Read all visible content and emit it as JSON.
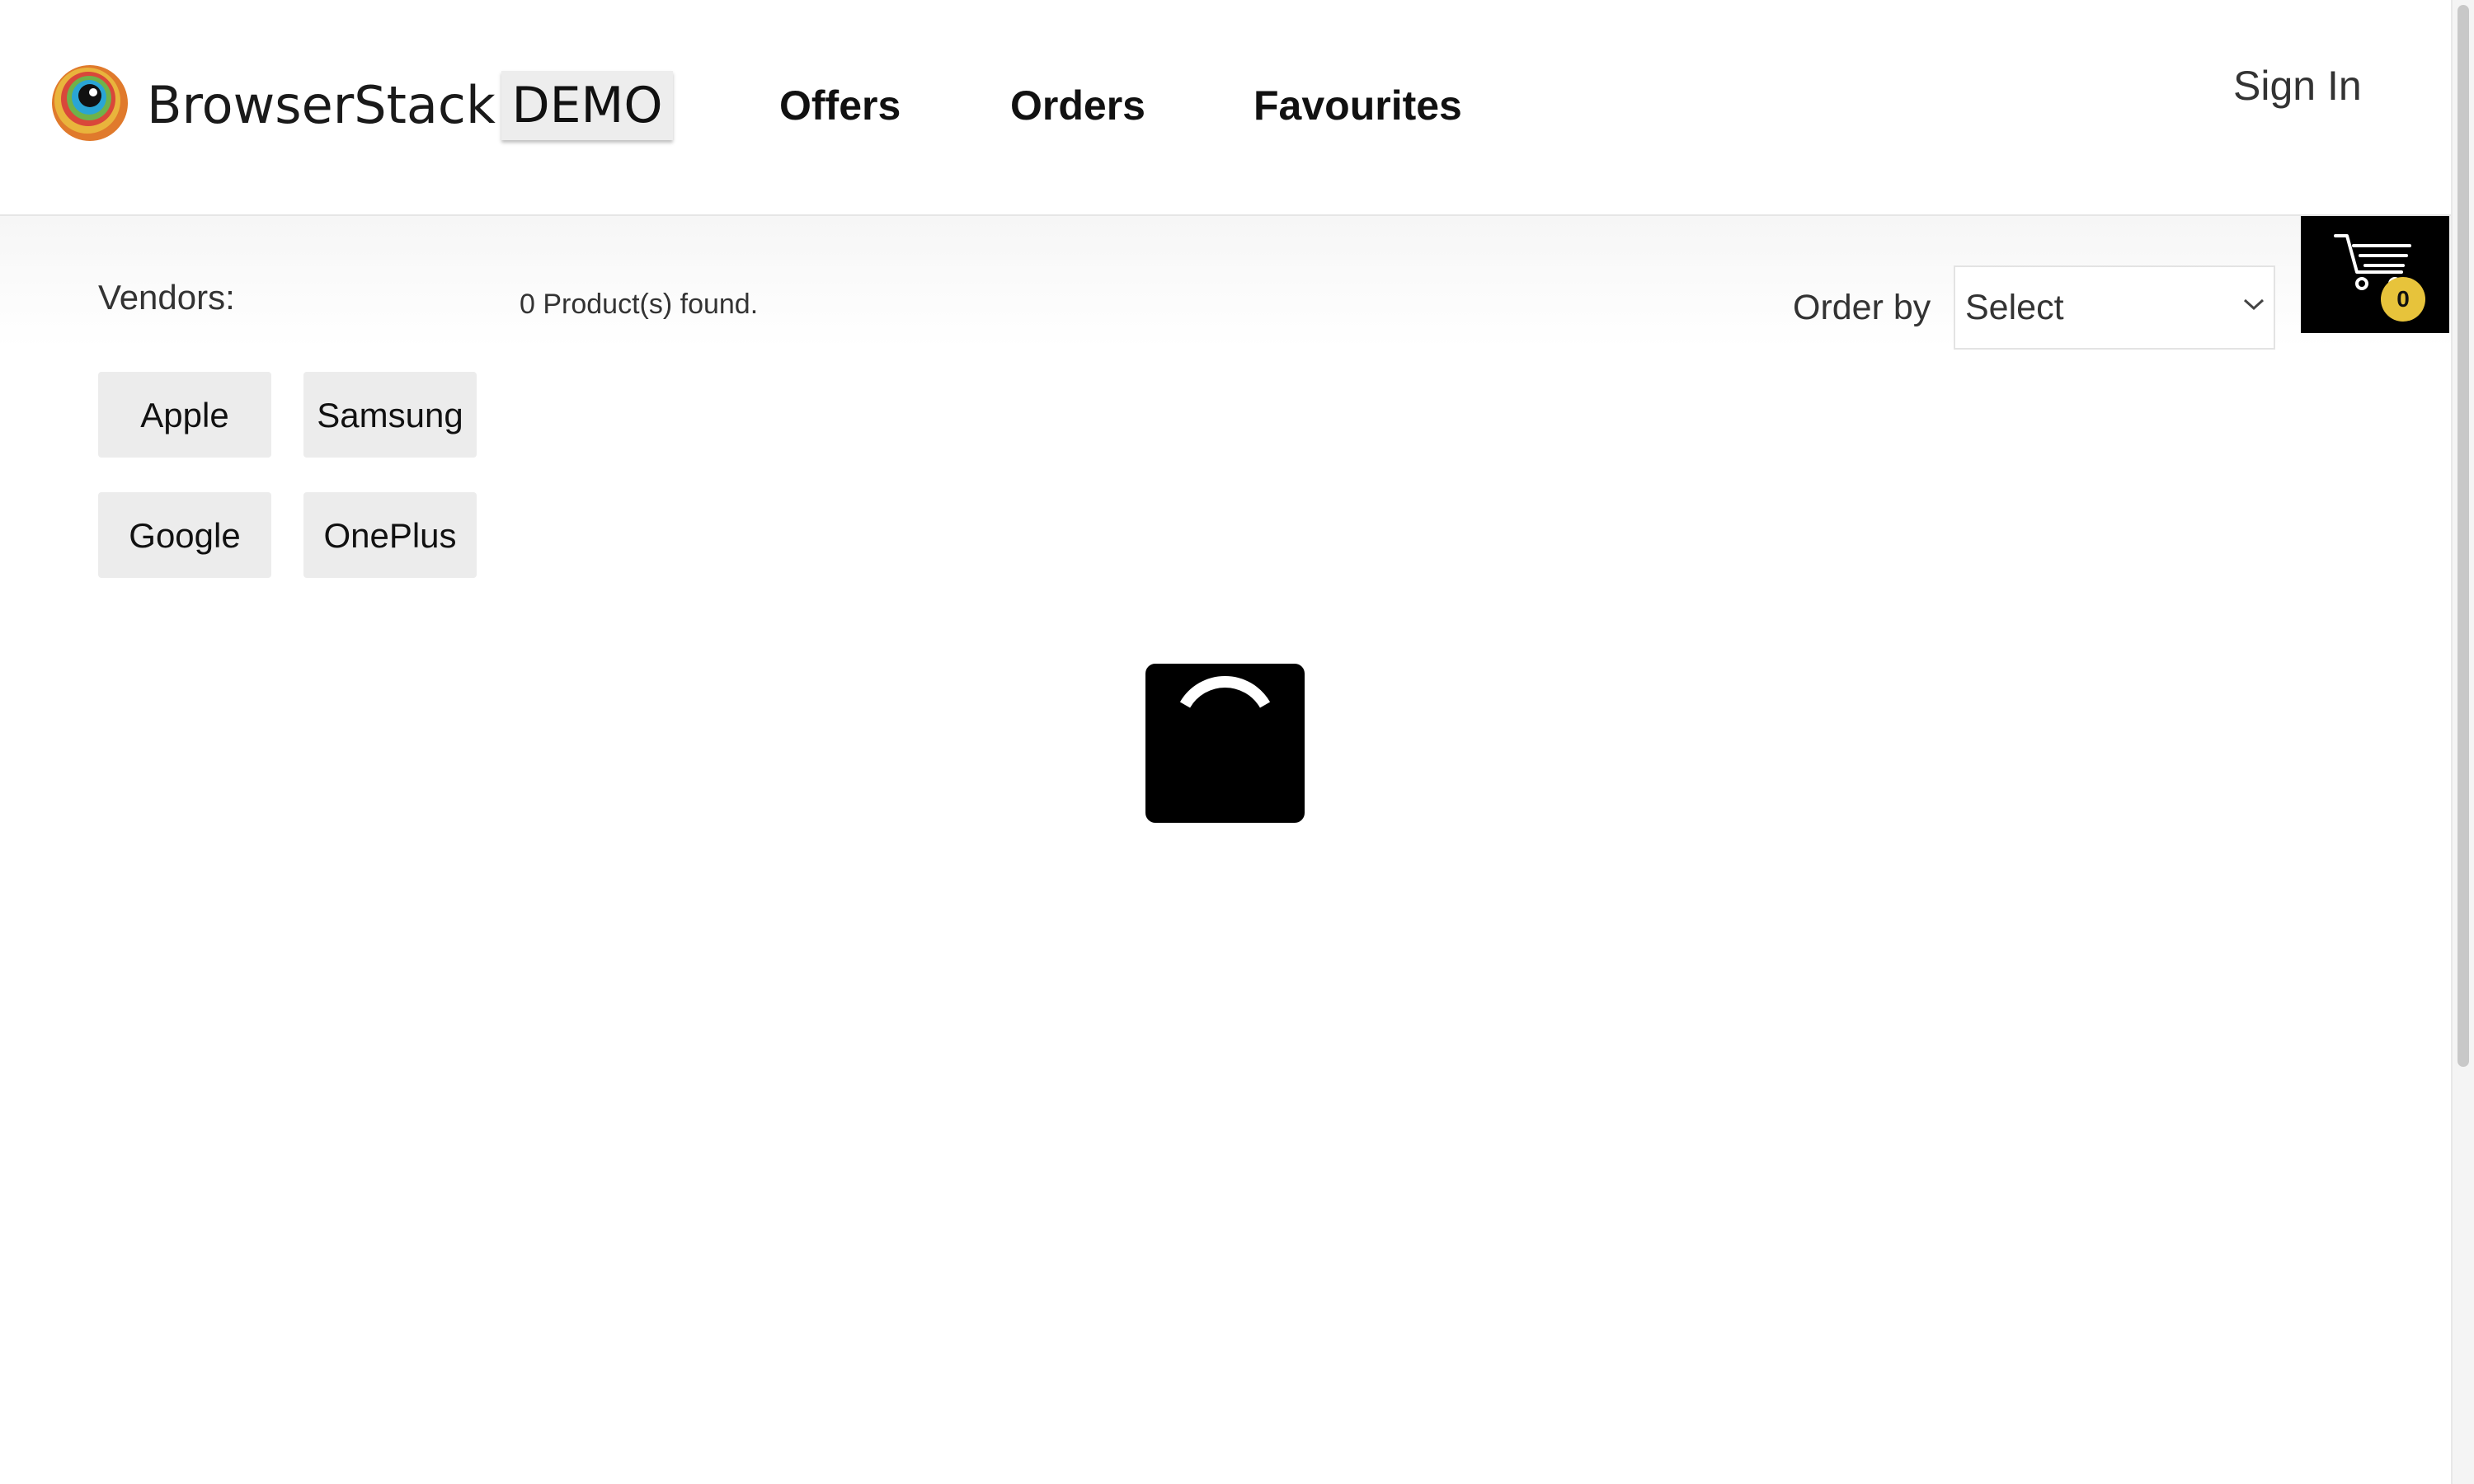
{
  "header": {
    "brand_name": "BrowserStack",
    "demo_badge": "DEMO",
    "nav": {
      "offers": "Offers",
      "orders": "Orders",
      "favourites": "Favourites"
    },
    "sign_in": "Sign In"
  },
  "cart": {
    "count": "0",
    "badge_color": "#e7c33b"
  },
  "filters": {
    "vendors_label": "Vendors:",
    "vendors": [
      "Apple",
      "Samsung",
      "Google",
      "OnePlus"
    ]
  },
  "results": {
    "products_found": "0 Product(s) found."
  },
  "sort": {
    "label": "Order by",
    "selected": "Select"
  },
  "icons": {
    "logo": "browserstack-logo-icon",
    "cart": "cart-icon",
    "spinner": "loading-spinner-icon",
    "chevron": "chevron-down-icon"
  }
}
